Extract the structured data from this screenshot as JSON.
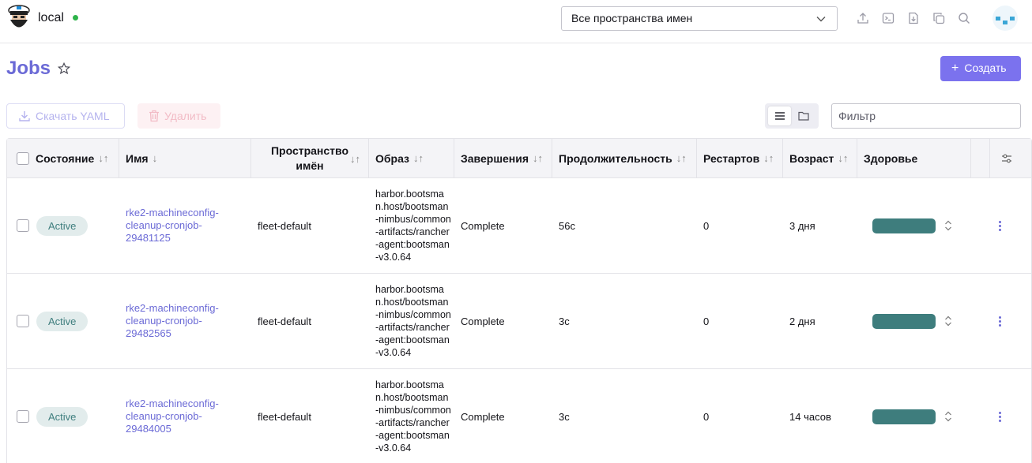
{
  "header": {
    "cluster_name": "local",
    "namespace_select": "Все пространства имен",
    "icons": [
      "upload-icon",
      "terminal-icon",
      "download-file-icon",
      "copy-icon",
      "search-icon"
    ]
  },
  "page": {
    "title": "Jobs",
    "create_label": "Создать",
    "download_yaml_label": "Скачать YAML",
    "delete_label": "Удалить",
    "filter_placeholder": "Фильтр"
  },
  "table": {
    "columns": {
      "state": "Состояние",
      "name": "Имя",
      "namespace_line1": "Пространство",
      "namespace_line2": "имён",
      "image": "Образ",
      "completions": "Завершения",
      "duration": "Продолжительность",
      "restarts": "Рестартов",
      "age": "Возраст",
      "health": "Здоровье"
    },
    "rows": [
      {
        "state": "Active",
        "name_l1": "rke2-machineconfig-",
        "name_l2": "cleanup-cronjob-",
        "name_l3": "29481125",
        "namespace": "fleet-default",
        "image": "harbor.bootsman.host/bootsman-nimbus/common-artifacts/rancher-agent:bootsman-v3.0.64",
        "completions": "Complete",
        "duration": "56с",
        "restarts": "0",
        "age": "3 дня",
        "health": 1.0
      },
      {
        "state": "Active",
        "name_l1": "rke2-machineconfig-",
        "name_l2": "cleanup-cronjob-",
        "name_l3": "29482565",
        "namespace": "fleet-default",
        "image": "harbor.bootsman.host/bootsman-nimbus/common-artifacts/rancher-agent:bootsman-v3.0.64",
        "completions": "Complete",
        "duration": "3с",
        "restarts": "0",
        "age": "2 дня",
        "health": 1.0
      },
      {
        "state": "Active",
        "name_l1": "rke2-machineconfig-",
        "name_l2": "cleanup-cronjob-",
        "name_l3": "29484005",
        "namespace": "fleet-default",
        "image": "harbor.bootsman.host/bootsman-nimbus/common-artifacts/rancher-agent:bootsman-v3.0.64",
        "completions": "Complete",
        "duration": "3с",
        "restarts": "0",
        "age": "14 часов",
        "health": 1.0
      }
    ]
  }
}
